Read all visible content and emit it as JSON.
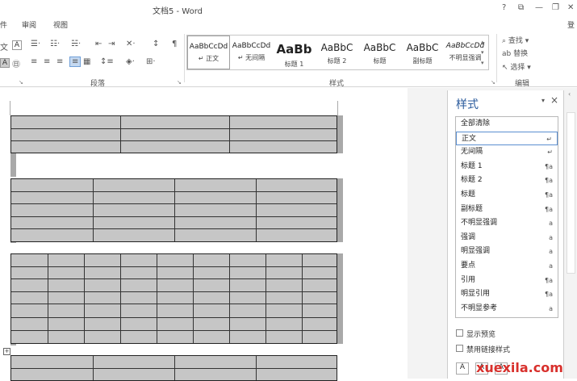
{
  "window": {
    "title": "文档5 - Word",
    "help": "?",
    "restore": "⧉",
    "min": "—",
    "max": "❐",
    "close": "✕",
    "login": "登"
  },
  "tabs": [
    "件",
    "审阅",
    "视图"
  ],
  "ribbon": {
    "groups": {
      "paragraph": "段落",
      "styles": "样式",
      "editing": "编辑"
    },
    "editing": {
      "find": "查找",
      "replace": "替换",
      "select": "选择"
    },
    "styles": [
      {
        "preview": "AaBbCcDd",
        "name": "↵ 正文",
        "size": 9
      },
      {
        "preview": "AaBbCcDd",
        "name": "↵ 无间隔",
        "size": 9
      },
      {
        "preview": "AaBb",
        "name": "标题 1",
        "size": 15
      },
      {
        "preview": "AaBbC",
        "name": "标题 2",
        "size": 12
      },
      {
        "preview": "AaBbC",
        "name": "标题",
        "size": 12
      },
      {
        "preview": "AaBbC",
        "name": "副标题",
        "size": 12
      },
      {
        "preview": "AaBbCcDd",
        "name": "不明显强调",
        "size": 9
      }
    ]
  },
  "pane": {
    "title": "样式",
    "items": [
      {
        "label": "全部清除",
        "mark": ""
      },
      {
        "label": "正文",
        "mark": "↵"
      },
      {
        "label": "无间隔",
        "mark": "↵"
      },
      {
        "label": "标题 1",
        "mark": "¶a"
      },
      {
        "label": "标题 2",
        "mark": "¶a"
      },
      {
        "label": "标题",
        "mark": "¶a"
      },
      {
        "label": "副标题",
        "mark": "¶a"
      },
      {
        "label": "不明显强调",
        "mark": "a"
      },
      {
        "label": "强调",
        "mark": "a"
      },
      {
        "label": "明显强调",
        "mark": "a"
      },
      {
        "label": "要点",
        "mark": "a"
      },
      {
        "label": "引用",
        "mark": "¶a"
      },
      {
        "label": "明显引用",
        "mark": "¶a"
      },
      {
        "label": "不明显参考",
        "mark": "a"
      }
    ],
    "show_preview": "显示预览",
    "disable_linked": "禁用链接样式"
  },
  "watermark": "xuexila.com"
}
